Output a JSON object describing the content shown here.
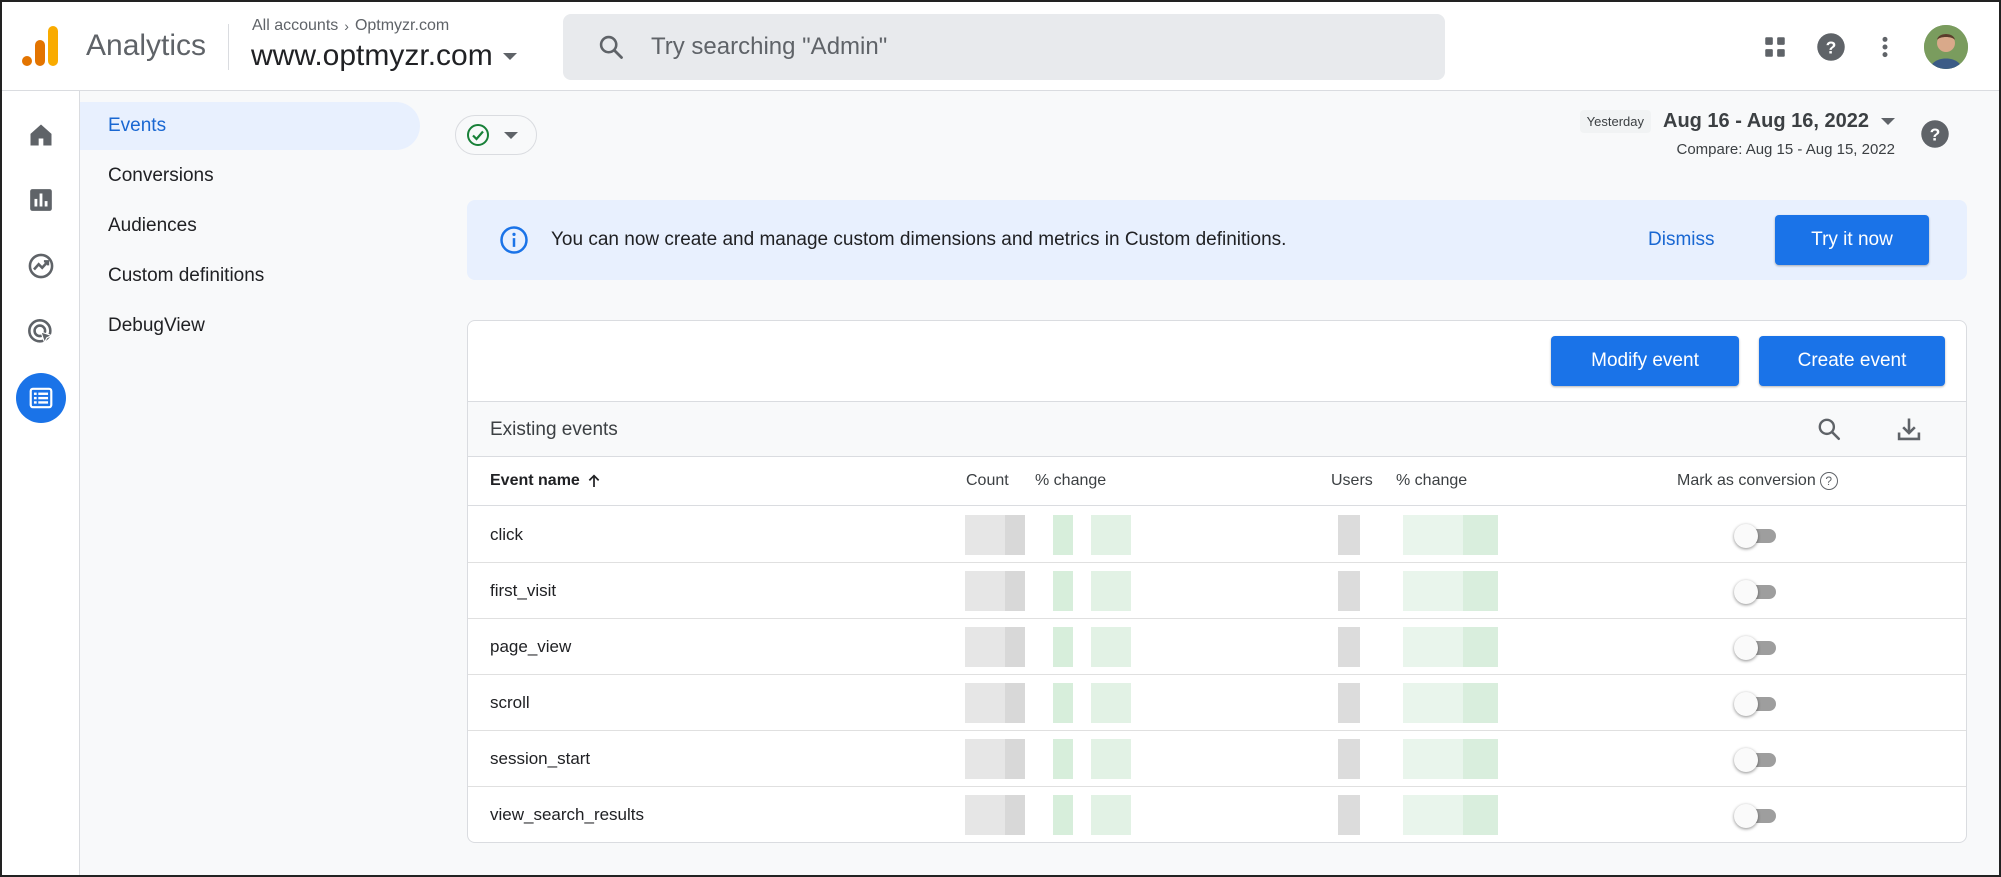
{
  "app": {
    "product_name": "Analytics",
    "breadcrumb": {
      "root": "All accounts",
      "account": "Optmyzr.com"
    },
    "property": "www.optmyzr.com"
  },
  "search": {
    "placeholder": "Try searching \"Admin\"",
    "value": ""
  },
  "rail": [
    "home-icon",
    "reports-icon",
    "explore-icon",
    "advertising-icon",
    "configure-icon"
  ],
  "subnav": {
    "items": [
      {
        "label": "Events",
        "active": true
      },
      {
        "label": "Conversions",
        "active": false
      },
      {
        "label": "Audiences",
        "active": false
      },
      {
        "label": "Custom definitions",
        "active": false
      },
      {
        "label": "DebugView",
        "active": false
      }
    ]
  },
  "date": {
    "label": "Yesterday",
    "range": "Aug 16 - Aug 16, 2022",
    "compare": "Compare: Aug 15 - Aug 15, 2022"
  },
  "banner": {
    "text": "You can now create and manage custom dimensions and metrics in Custom definitions.",
    "dismiss": "Dismiss",
    "cta": "Try it now"
  },
  "card": {
    "modify_label": "Modify event",
    "create_label": "Create event",
    "title": "Existing events",
    "columns": {
      "event_name": "Event name",
      "count": "Count",
      "count_change": "% change",
      "users": "Users",
      "users_change": "% change",
      "conversion": "Mark as conversion"
    },
    "rows": [
      {
        "name": "click",
        "conversion": false
      },
      {
        "name": "first_visit",
        "conversion": false
      },
      {
        "name": "page_view",
        "conversion": false
      },
      {
        "name": "scroll",
        "conversion": false
      },
      {
        "name": "session_start",
        "conversion": false
      },
      {
        "name": "view_search_results",
        "conversion": false
      }
    ]
  },
  "colors": {
    "accent": "#1a73e8",
    "banner_bg": "#e8f0fe",
    "active_nav": "#1967d2",
    "success": "#188038"
  }
}
